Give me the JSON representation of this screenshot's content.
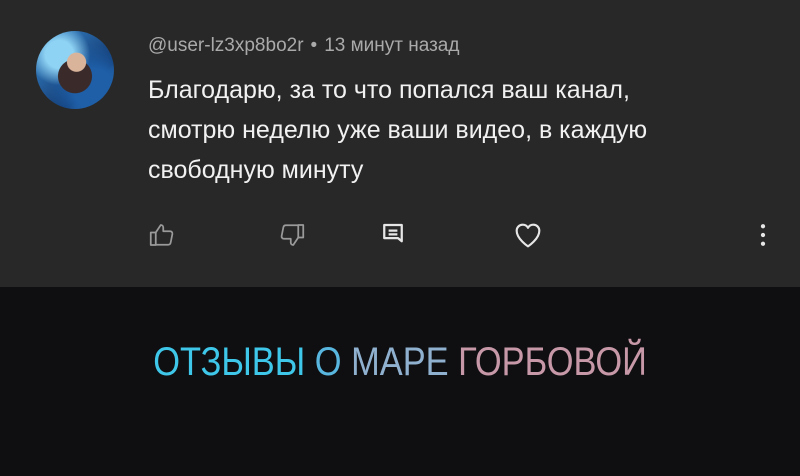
{
  "comment": {
    "author": "@user-lz3xp8bo2r",
    "separator": "•",
    "time": "13 минут назад",
    "text_lines": [
      "Благодарю, за то что попался ваш канал,",
      "смотрю неделю уже ваши видео, в каждую",
      "свободную минуту"
    ],
    "actions": {
      "like_icon": "thumb-up-icon",
      "dislike_icon": "thumb-down-icon",
      "reply_icon": "reply-comment-icon",
      "heart_icon": "heart-icon",
      "more_icon": "more-vertical-icon"
    }
  },
  "promo": {
    "words": [
      "ОТЗЫВЫ",
      "О",
      "МАРЕ",
      "ГОРБОВОЙ"
    ],
    "colors": [
      "#3fc7ea",
      "#58b6df",
      "#8fb0ce",
      "#c798a8"
    ]
  },
  "colors": {
    "card_background": "#282828",
    "page_background": "#0f0f11",
    "meta_text": "#aaaaaa",
    "body_text": "#f1f1f1"
  }
}
